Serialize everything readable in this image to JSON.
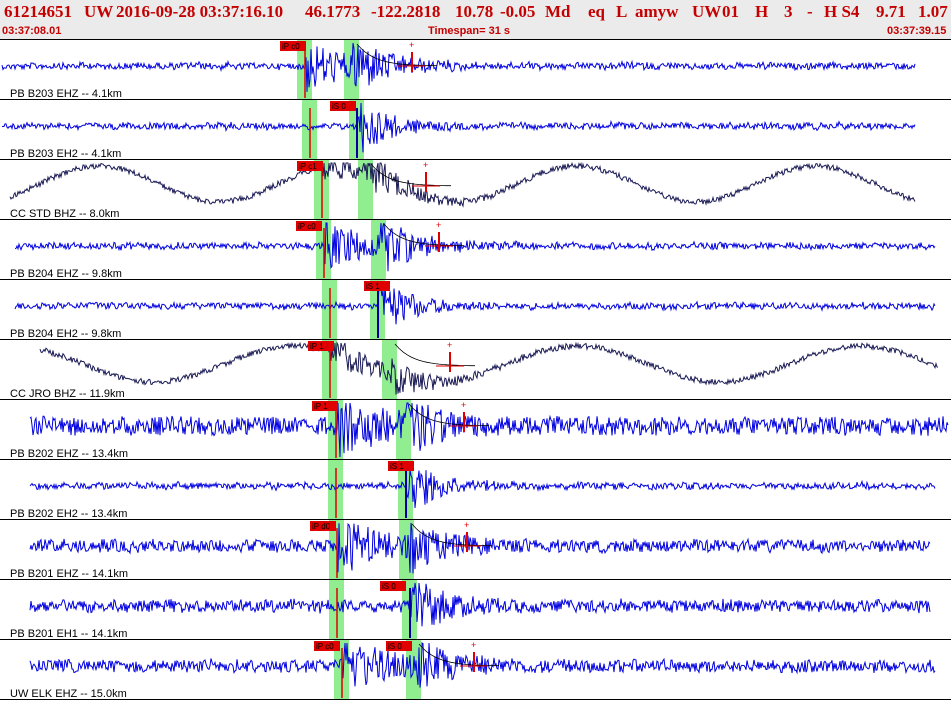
{
  "header": {
    "event_id": "61214651",
    "network": "UW",
    "datetime": "2016-09-28 03:37:16.10",
    "latitude": "46.1773",
    "longitude": "-122.2818",
    "depth": "10.78",
    "magnitude": "-0.05",
    "mag_type": "Md",
    "event_type": "eq",
    "location_code": "L",
    "analyst": "amyw",
    "auth": "UW",
    "version": "01",
    "field_h": "H",
    "field_3": "3",
    "field_dash": "-",
    "field_hs4": "H S4",
    "value_1": "9.71",
    "value_2": "1.07",
    "start_time": "03:37:08.01",
    "timespan": "Timespan=  31 s",
    "end_time": "03:37:39.15"
  },
  "colors": {
    "trace": "#0000e0",
    "trace_dark": "#1a1a55",
    "pick": "#e00000",
    "window": "#90ee90",
    "header_bg": "#ebebeb",
    "header_text": "#c40000"
  },
  "channels": [
    {
      "label": "PB B203 EHZ -- 4.1km",
      "type": "z",
      "dark": false,
      "amp": "low",
      "phases": [
        {
          "name": "iP c0"
        }
      ]
    },
    {
      "label": "PB B203 EH2 -- 4.1km",
      "type": "h",
      "dark": false,
      "amp": "low",
      "phases": [
        {
          "name": "iS 0"
        }
      ]
    },
    {
      "label": "CC STD BHZ -- 8.0km",
      "type": "z",
      "dark": true,
      "amp": "wave",
      "phases": [
        {
          "name": "iP c1"
        }
      ]
    },
    {
      "label": "PB B204 EHZ -- 9.8km",
      "type": "z",
      "dark": false,
      "amp": "low",
      "phases": [
        {
          "name": "iP c0"
        }
      ]
    },
    {
      "label": "PB B204 EH2 -- 9.8km",
      "type": "h",
      "dark": false,
      "amp": "low",
      "phases": [
        {
          "name": "iS 1"
        }
      ]
    },
    {
      "label": "CC JRO BHZ -- 11.9km",
      "type": "z",
      "dark": true,
      "amp": "wave",
      "phases": [
        {
          "name": "iP 1"
        }
      ]
    },
    {
      "label": "PB B202 EHZ -- 13.4km",
      "type": "z",
      "dark": false,
      "amp": "high",
      "phases": [
        {
          "name": "iP 1"
        }
      ]
    },
    {
      "label": "PB B202 EH2 -- 13.4km",
      "type": "h",
      "dark": false,
      "amp": "low",
      "phases": [
        {
          "name": "iS 1"
        }
      ]
    },
    {
      "label": "PB B201 EHZ -- 14.1km",
      "type": "z",
      "dark": false,
      "amp": "mid",
      "phases": [
        {
          "name": "iP d0"
        }
      ]
    },
    {
      "label": "PB B201 EH1 -- 14.1km",
      "type": "h",
      "dark": false,
      "amp": "mid",
      "phases": [
        {
          "name": "iS 0"
        }
      ]
    },
    {
      "label": "UW ELK EHZ -- 15.0km",
      "type": "z",
      "dark": false,
      "amp": "mid",
      "phases": [
        {
          "name": "iP c0"
        },
        {
          "name": "iS 0"
        }
      ]
    }
  ]
}
